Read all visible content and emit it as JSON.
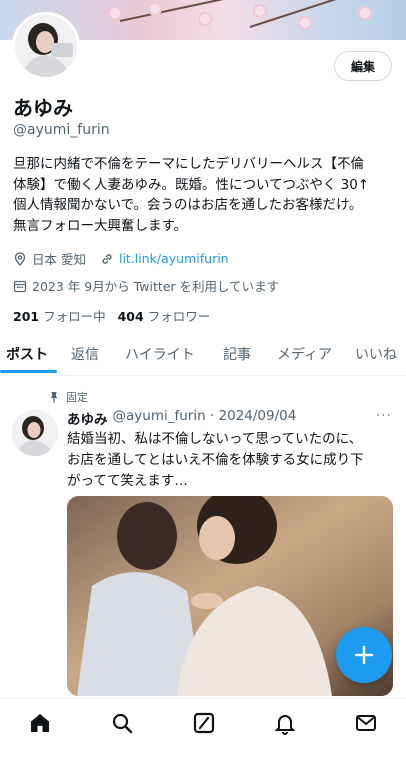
{
  "profile": {
    "name": "あゆみ",
    "handle": "@ayumi_furin",
    "edit_label": "編集",
    "bio_lines": [
      "旦那に内緒で不倫をテーマにしたデリバリーヘルス【不倫",
      "体験】で働く人妻あゆみ。既婚。性についてつぶやく 30↑",
      "個人情報聞かないで。会うのはお店を通したお客様だけ。",
      "無言フォロー大興奮します。"
    ],
    "location": "日本 愛知",
    "link": "lit.link/ayumifurin",
    "joined": "2023 年 9月から Twitter を利用しています",
    "following_count": "201",
    "following_label": "フォロー中",
    "followers_count": "404",
    "followers_label": "フォロワー"
  },
  "tabs": [
    "ポスト",
    "返信",
    "ハイライト",
    "記事",
    "メディア",
    "いいね"
  ],
  "tweet": {
    "pinned_label": "固定",
    "name": "あゆみ",
    "handle_date": "@ayumi_furin · 2024/09/04",
    "more": "···",
    "text_lines": [
      "結婚当初、私は不倫しないって思っていたのに、",
      "お店を通してとはいえ不倫を体験する女に成り下",
      "がってて笑えます…"
    ]
  },
  "fab_label": "+",
  "colors": {
    "accent": "#1d9bf0",
    "text": "#0f1419",
    "muted": "#536471"
  },
  "icons": {
    "location": "map-pin-icon",
    "link": "link-icon",
    "calendar": "calendar-icon",
    "pin": "pin-icon",
    "nav": [
      "home-icon",
      "search-icon",
      "grok-icon",
      "notifications-icon",
      "messages-icon"
    ]
  }
}
